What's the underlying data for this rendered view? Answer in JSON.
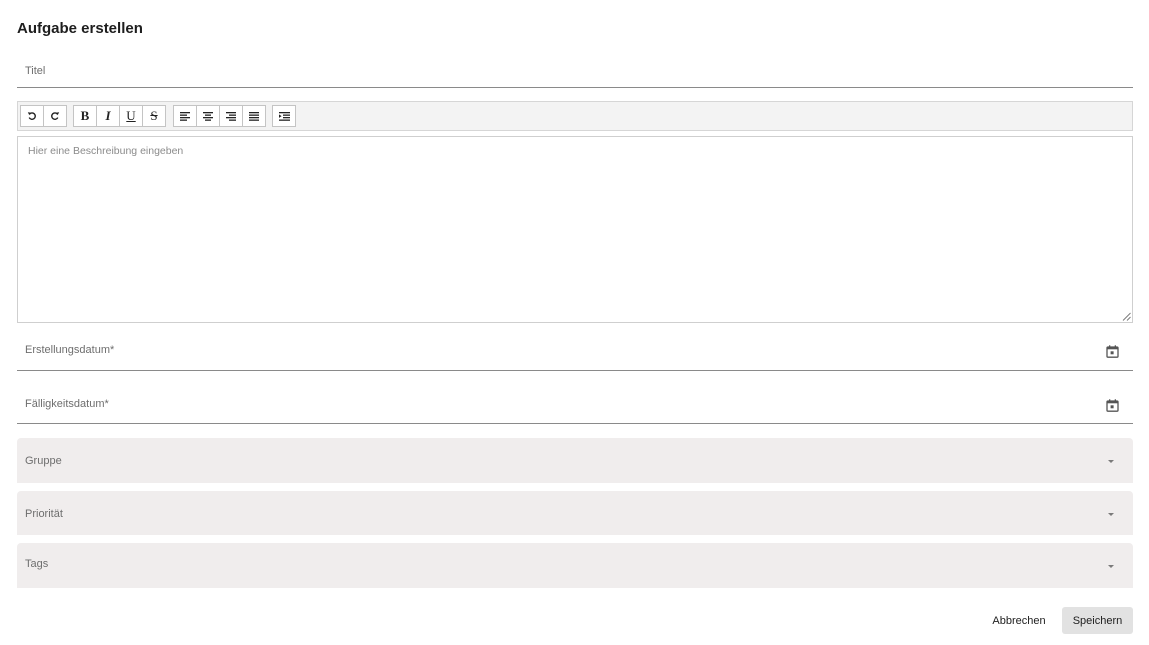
{
  "dialog": {
    "title": "Aufgabe erstellen"
  },
  "form": {
    "title_label": "Titel",
    "description_placeholder": "Hier eine Beschreibung eingeben",
    "creation_date_label": "Erstellungsdatum*",
    "due_date_label": "Fälligkeitsdatum*",
    "group_label": "Gruppe",
    "priority_label": "Priorität",
    "tags_label": "Tags"
  },
  "toolbar": {
    "undo_icon": "undo-icon",
    "redo_icon": "redo-icon",
    "bold_label": "B",
    "italic_label": "I",
    "underline_label": "U",
    "strike_label": "S",
    "align_icons": [
      "align-left-icon",
      "align-center-icon",
      "align-right-icon",
      "align-justify-icon"
    ],
    "indent_icon": "indent-icon"
  },
  "actions": {
    "cancel_label": "Abbrechen",
    "save_label": "Speichern"
  },
  "colors": {
    "select_background": "#f0eded",
    "save_button_background": "#e2e2e2"
  }
}
